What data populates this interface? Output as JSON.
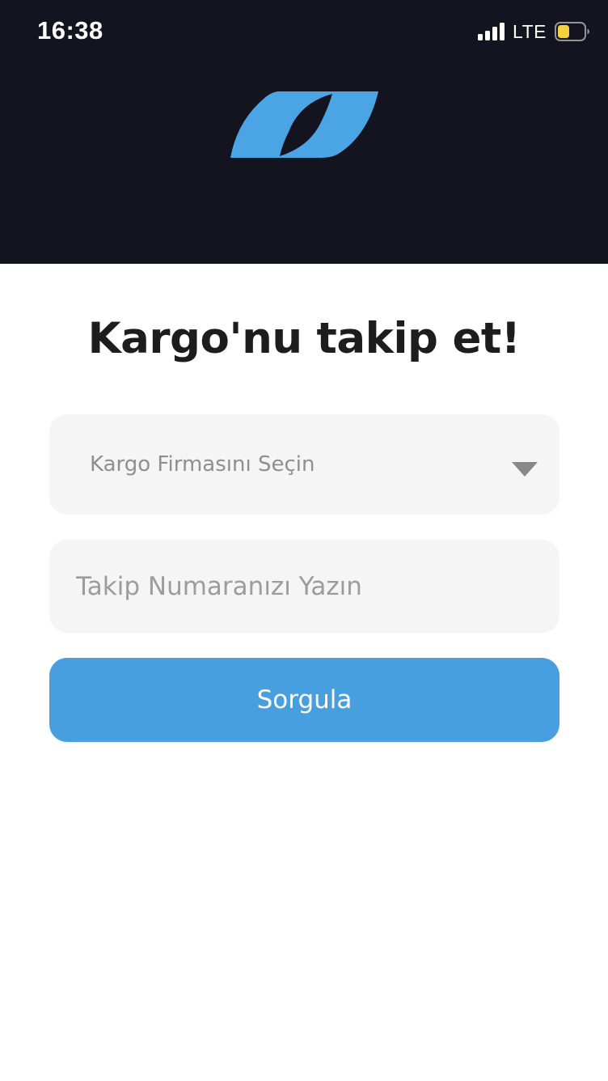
{
  "status_bar": {
    "time": "16:38",
    "network": "LTE",
    "icons": [
      "signal-icon",
      "battery-icon"
    ],
    "battery_level": 0.45,
    "battery_color": "#f4d23c"
  },
  "header": {
    "background": "#141320",
    "logo_icon": "leaf-logo-icon",
    "logo_color": "#4ba5e4"
  },
  "main": {
    "title": "Kargo'nu takip et!",
    "carrier_select": {
      "placeholder": "Kargo Firmasını Seçin",
      "icon": "chevron-down-icon"
    },
    "tracking_input": {
      "value": "",
      "placeholder": "Takip Numaranızı Yazın"
    },
    "submit_label": "Sorgula",
    "accent_color": "#489fdf"
  }
}
